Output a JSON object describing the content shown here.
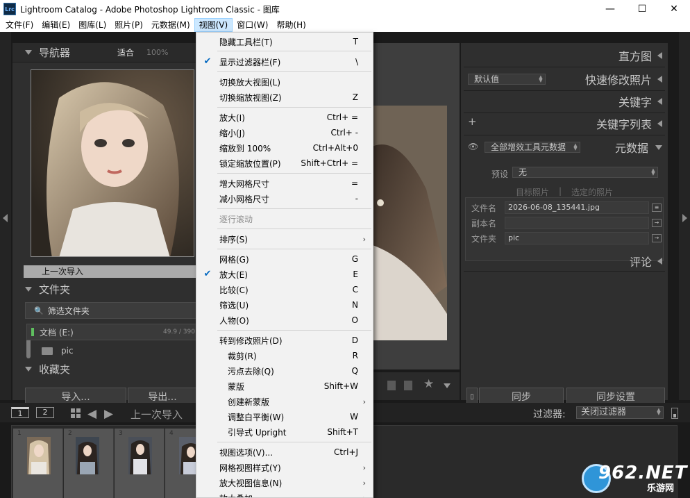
{
  "window": {
    "app_icon": "Lrc",
    "title": "Lightroom Catalog - Adobe Photoshop Lightroom Classic - 图库",
    "minimize": "—",
    "maximize": "☐",
    "close": "✕"
  },
  "menubar": [
    {
      "label": "文件(F)"
    },
    {
      "label": "编辑(E)"
    },
    {
      "label": "图库(L)"
    },
    {
      "label": "照片(P)"
    },
    {
      "label": "元数据(M)"
    },
    {
      "label": "视图(V)"
    },
    {
      "label": "窗口(W)"
    },
    {
      "label": "帮助(H)"
    }
  ],
  "left": {
    "navigator_title": "导航器",
    "zoom_fit": "适合",
    "zoom_100": "100%",
    "previous_import": "上一次导入",
    "folders_title": "文件夹",
    "search_folders": "筛选文件夹",
    "drive_name": "文档 (E:)",
    "drive_space": "49.9 / 390",
    "folder_name": "pic",
    "collections_title": "收藏夹",
    "import_button": "导入...",
    "export_button": "导出..."
  },
  "right": {
    "histogram_title": "直方图",
    "preset_default": "默认值",
    "quick_develop_title": "快速修改照片",
    "keywording_title": "关键字",
    "keyword_list_title": "关键字列表",
    "plus": "+",
    "metadata_set": "全部增效工具元数据",
    "metadata_title": "元数据",
    "preset_label": "预设",
    "preset_value": "无",
    "target_photo": "目标照片",
    "selected_photos": "选定的照片",
    "filename_label": "文件名",
    "filename_value": "2026-06-08_135441.jpg",
    "copy_name_label": "副本名",
    "folder_label": "文件夹",
    "folder_value": "pic",
    "comments_title": "评论",
    "sync_button": "同步",
    "sync_settings_button": "同步设置"
  },
  "filmstrip": {
    "page1": "1",
    "page2": "2",
    "source": "上一次导入",
    "filter_label": "过滤器:",
    "filter_value": "关闭过滤器",
    "thumbs": [
      {
        "num": "1"
      },
      {
        "num": "2"
      },
      {
        "num": "3"
      },
      {
        "num": "4"
      }
    ]
  },
  "view_menu": {
    "items": [
      {
        "label": "隐藏工具栏(T)",
        "shortcut": "T"
      },
      {
        "label": "显示过滤器栏(F)",
        "shortcut": "\\",
        "checked": true
      },
      {
        "label": "切换放大视图(L)",
        "shortcut": ""
      },
      {
        "label": "切换缩放视图(Z)",
        "shortcut": "Z"
      },
      {
        "label": "放大(I)",
        "shortcut": "Ctrl+ ="
      },
      {
        "label": "缩小(J)",
        "shortcut": "Ctrl+ -"
      },
      {
        "label": "缩放到 100%",
        "shortcut": "Ctrl+Alt+0"
      },
      {
        "label": "锁定缩放位置(P)",
        "shortcut": "Shift+Ctrl+ ="
      },
      {
        "label": "增大网格尺寸",
        "shortcut": "="
      },
      {
        "label": "减小网格尺寸",
        "shortcut": "-"
      },
      {
        "label": "逐行滚动",
        "shortcut": "",
        "disabled": true
      },
      {
        "label": "排序(S)",
        "shortcut": "",
        "submenu": true
      },
      {
        "label": "网格(G)",
        "shortcut": "G"
      },
      {
        "label": "放大(E)",
        "shortcut": "E",
        "checked": true
      },
      {
        "label": "比较(C)",
        "shortcut": "C"
      },
      {
        "label": "筛选(U)",
        "shortcut": "N"
      },
      {
        "label": "人物(O)",
        "shortcut": "O"
      },
      {
        "label": "转到修改照片(D)",
        "shortcut": "D"
      },
      {
        "label": "裁剪(R)",
        "shortcut": "R",
        "indent": true
      },
      {
        "label": "污点去除(Q)",
        "shortcut": "Q",
        "indent": true
      },
      {
        "label": "蒙版",
        "shortcut": "Shift+W",
        "indent": true
      },
      {
        "label": "创建新蒙版",
        "shortcut": "",
        "indent": true,
        "submenu": true
      },
      {
        "label": "调整白平衡(W)",
        "shortcut": "W",
        "indent": true
      },
      {
        "label": "引导式 Upright",
        "shortcut": "Shift+T",
        "indent": true
      },
      {
        "label": "视图选项(V)...",
        "shortcut": "Ctrl+J"
      },
      {
        "label": "网格视图样式(Y)",
        "shortcut": "",
        "submenu": true
      },
      {
        "label": "放大视图信息(N)",
        "shortcut": "",
        "submenu": true
      },
      {
        "label": "放大叠加",
        "shortcut": "",
        "submenu": true
      }
    ],
    "check_glyph": "✔",
    "submenu_glyph": "›"
  },
  "watermark": {
    "brand": "962.NET",
    "sub": "乐游网"
  }
}
